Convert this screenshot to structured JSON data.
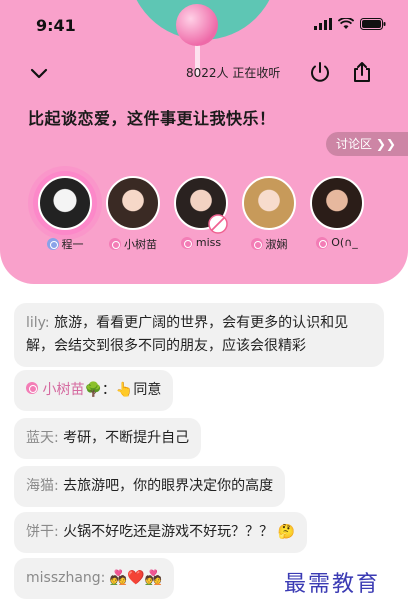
{
  "status_bar": {
    "time": "9:41"
  },
  "header": {
    "listener_count": "8022人",
    "listener_label": "正在收听",
    "room_title": "比起谈恋爱，这件事更让我快乐！",
    "discuss_label": "讨论区",
    "discuss_arrow": "❯❯"
  },
  "members": [
    {
      "name": "程一",
      "badge": "blue"
    },
    {
      "name": "小树苗",
      "badge": "pink"
    },
    {
      "name": "miss",
      "badge": "pink",
      "muted": true
    },
    {
      "name": "淑娴",
      "badge": "pink"
    },
    {
      "name": "O(∩_",
      "badge": "pink"
    }
  ],
  "messages": [
    {
      "sender": "lily:",
      "text": "旅游，看看更广阔的世界，会有更多的认识和见解，会结交到很多不同的朋友，应该会很精彩"
    },
    {
      "sender": "小树苗",
      "text": "：👆同意",
      "emoji_after_sender": "🌳"
    },
    {
      "sender": "蓝天:",
      "text": "考研，不断提升自己"
    },
    {
      "sender": "海猫:",
      "text": "去旅游吧，你的眼界决定你的高度"
    },
    {
      "sender": "饼干:",
      "text": "火锅不好吃还是游戏不好玩？？？ 🤔"
    },
    {
      "sender": "misszhang:",
      "text": "💑❤️💑"
    }
  ],
  "watermark": "最需教育",
  "colors": {
    "header_bg": "#f9a1cb",
    "accent": "#f37db6",
    "bubble_bg": "#f1f1f1"
  }
}
